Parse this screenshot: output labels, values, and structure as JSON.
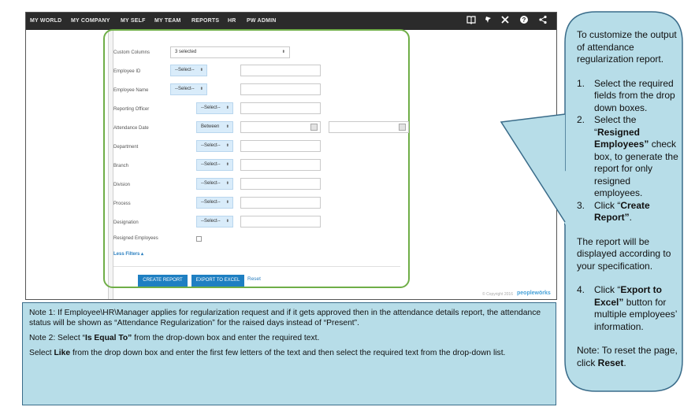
{
  "nav": {
    "items": [
      "MY WORLD",
      "MY COMPANY",
      "MY SELF",
      "MY TEAM",
      "REPORTS",
      "HR",
      "PW ADMIN"
    ],
    "icons": [
      "book-icon",
      "pin-icon",
      "tools-icon",
      "help-icon",
      "share-icon"
    ]
  },
  "form": {
    "custom_columns": {
      "label": "Custom Columns",
      "value": "3 selected"
    },
    "rows": [
      {
        "label": "Employee ID",
        "select": "--Select--"
      },
      {
        "label": "Employee Name",
        "select": "--Select--"
      },
      {
        "label": "Reporting Officer",
        "select": "--Select--"
      },
      {
        "label": "Attendance Date",
        "select": "Between"
      },
      {
        "label": "Department",
        "select": "--Select--"
      },
      {
        "label": "Branch",
        "select": "--Select--"
      },
      {
        "label": "Division",
        "select": "--Select--"
      },
      {
        "label": "Process",
        "select": "--Select--"
      },
      {
        "label": "Designation",
        "select": "--Select--"
      }
    ],
    "resigned_label": "Resigned Employees",
    "less_filters": "Less Filters ▴",
    "create_report": "CREATE REPORT",
    "export_excel": "EXPORT TO EXCEL",
    "reset": "Reset"
  },
  "footer": {
    "copyright": "© Copyright 2016",
    "brand": "peoplewörks"
  },
  "callout": {
    "intro": "To customize the output of attendance regularization report.",
    "step1_num": "1.",
    "step1": "Select the required fields from the drop down boxes.",
    "step2_num": "2.",
    "step2_a": "Select the “",
    "step2_bold": "Resigned Employees”",
    "step2_b": " check box, to generate the report for only resigned employees.",
    "step3_num": "3.",
    "step3_a": "Click “",
    "step3_bold": "Create Report”",
    "step3_b": ".",
    "middle": "The report will be displayed according to your specification.",
    "step4_num": "4.",
    "step4_a": "Click “",
    "step4_bold": "Export to Excel”",
    "step4_b": " button for multiple employees’ information.",
    "note_a": "Note: To reset the page, click ",
    "note_bold": "Reset",
    "note_b": "."
  },
  "notes": {
    "note1": "Note 1: If Employee\\HR\\Manager applies for regularization request and if it gets approved then in the attendance details report, the attendance status will be shown as “Attendance Regularization” for the raised days instead of “Present”.",
    "note2_a": "Note 2: Select “",
    "note2_bold": "Is Equal To”",
    "note2_b": " from the drop-down box and enter the required text.",
    "note3_a": "Select ",
    "note3_bold": "Like",
    "note3_b": " from the drop down box and enter the first few letters of the text and then select the required text from the drop-down list."
  },
  "colors": {
    "nav_bg": "#2b2b2b",
    "form_border": "#6fae47",
    "button": "#1e7fc2",
    "callout_bg": "#b7dde8",
    "notes_bg": "#b7dde8"
  }
}
